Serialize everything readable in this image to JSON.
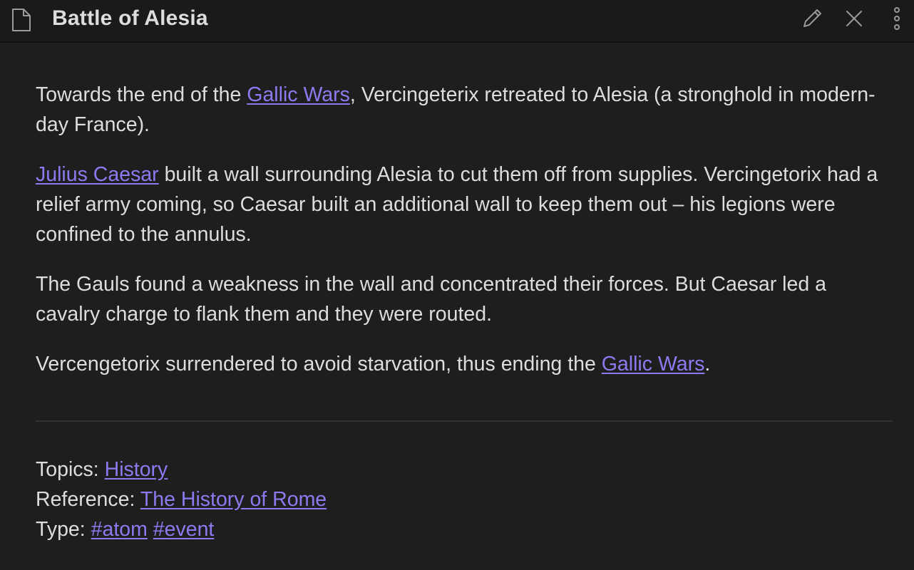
{
  "header": {
    "title": "Battle of Alesia",
    "icons": {
      "document": "document-icon",
      "edit": "pencil-icon",
      "close": "close-icon",
      "more": "more-options-icon"
    }
  },
  "colors": {
    "background": "#1e1e1e",
    "titlebar": "#1a1a1a",
    "text": "#dcddde",
    "link": "#8a7cf0",
    "divider": "#333333"
  },
  "body": {
    "p1": {
      "before": "Towards the end of the ",
      "link": "Gallic Wars",
      "after": ", Vercingeterix retreated to Alesia (a stronghold in modern-day France)."
    },
    "p2": {
      "link": "Julius Caesar",
      "after": " built a wall surrounding Alesia to cut them off from supplies. Vercingetorix had a relief army coming, so Caesar built an additional wall to keep them out – his legions were confined to the annulus."
    },
    "p3": {
      "text": "The Gauls found a weakness in the wall and concentrated their forces. But Caesar led a cavalry charge to flank them and they were routed."
    },
    "p4": {
      "before": "Vercengetorix surrendered to avoid starvation, thus ending the ",
      "link": "Gallic Wars",
      "after": "."
    }
  },
  "meta": {
    "topics_label": "Topics: ",
    "topics_link": "History",
    "reference_label": "Reference: ",
    "reference_link": "The History of Rome",
    "type_label": "Type: ",
    "type_tag1": "#atom",
    "type_tag2": "#event"
  }
}
